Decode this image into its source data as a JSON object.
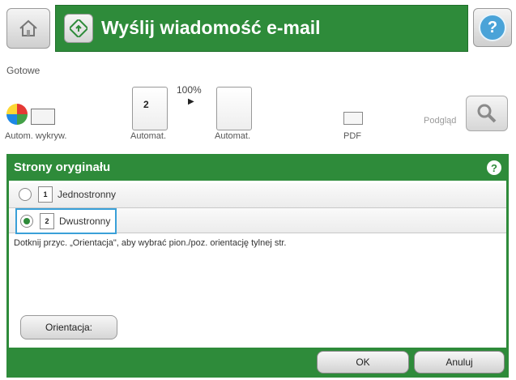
{
  "header": {
    "title": "Wyślij wiadomość e-mail",
    "help_icon": "?",
    "home_icon": "home-icon",
    "title_icon": "email-start-icon"
  },
  "status": {
    "text": "Gotowe"
  },
  "settings": {
    "scale": "100%",
    "color_label": "Autom. wykryw.",
    "sides_label": "Automat.",
    "sides_number": "2",
    "size_label": "Automat.",
    "format_label": "PDF",
    "preview_label": "Podgląd"
  },
  "dialog": {
    "title": "Strony oryginału",
    "help_icon": "?",
    "options": [
      {
        "number": "1",
        "label": "Jednostronny",
        "selected": false
      },
      {
        "number": "2",
        "label": "Dwustronny",
        "selected": true
      }
    ],
    "hint": "Dotknij przyc. „Orientacja\", aby wybrać pion./poz. orientację tylnej str.",
    "orientation_button": "Orientacja:",
    "ok_button": "OK",
    "cancel_button": "Anuluj"
  },
  "colors": {
    "accent": "#2e8b3a",
    "selection": "#3aa0d8"
  }
}
